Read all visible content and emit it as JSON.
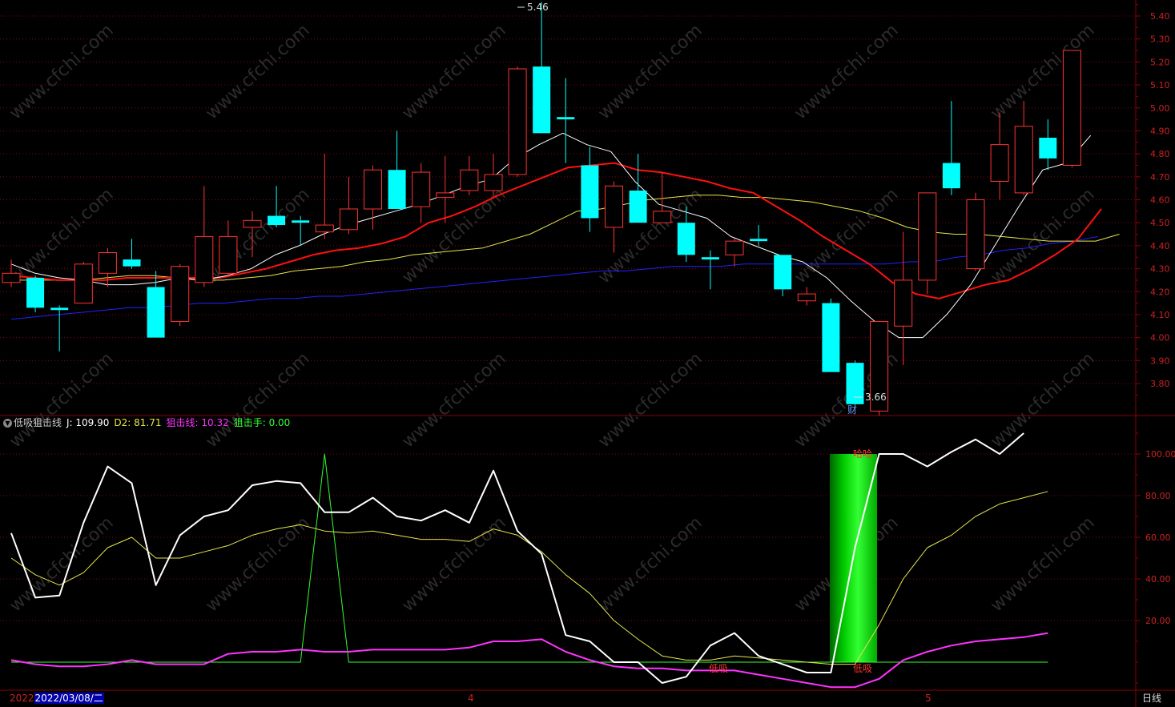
{
  "colors": {
    "up": "#ff3333",
    "down": "#00ffff",
    "grid": "#8b0000",
    "axis_text": "#cc2222",
    "ma5": "#ffffff",
    "ma10": "#ff1010",
    "ma20": "#e6e64d",
    "ma60": "#2222ff",
    "j_line": "#ffffff",
    "d2_line": "#e6e64d",
    "snipe_line": "#ff33ff",
    "sniper_hand": "#33ff33",
    "signal_bar": "#00dd00"
  },
  "header": {
    "indicator_name": "低吸狙击线",
    "j_label": "J: 109.90",
    "d2_label": "D2: 81.71",
    "snipe_label": "狙击线: 10.32",
    "hand_label": "狙击手: 0.00"
  },
  "bottom": {
    "year": "2022",
    "cursor_date": "2022/03/08/二",
    "month_4": "4",
    "month_5": "5",
    "period": "日线"
  },
  "chart_data": [
    {
      "type": "candlestick",
      "y_ticks": [
        5.4,
        5.3,
        5.2,
        5.1,
        5.0,
        4.9,
        4.8,
        4.7,
        4.6,
        4.5,
        4.4,
        4.3,
        4.2,
        4.1,
        4.0,
        3.9,
        3.8
      ],
      "ylim": [
        3.66,
        5.46
      ],
      "annotations": {
        "high": "5.46",
        "low": "3.66",
        "marker": "财"
      },
      "candles": [
        {
          "o": 4.24,
          "h": 4.34,
          "l": 4.22,
          "c": 4.28
        },
        {
          "o": 4.26,
          "h": 4.27,
          "l": 4.11,
          "c": 4.13
        },
        {
          "o": 4.13,
          "h": 4.14,
          "l": 3.94,
          "c": 4.12
        },
        {
          "o": 4.15,
          "h": 4.33,
          "l": 4.15,
          "c": 4.32
        },
        {
          "o": 4.28,
          "h": 4.39,
          "l": 4.22,
          "c": 4.37
        },
        {
          "o": 4.34,
          "h": 4.43,
          "l": 4.3,
          "c": 4.31
        },
        {
          "o": 4.22,
          "h": 4.29,
          "l": 4.0,
          "c": 4.0
        },
        {
          "o": 4.07,
          "h": 4.32,
          "l": 4.05,
          "c": 4.31
        },
        {
          "o": 4.24,
          "h": 4.66,
          "l": 4.22,
          "c": 4.44
        },
        {
          "o": 4.28,
          "h": 4.51,
          "l": 4.27,
          "c": 4.44
        },
        {
          "o": 4.48,
          "h": 4.55,
          "l": 4.35,
          "c": 4.51
        },
        {
          "o": 4.53,
          "h": 4.66,
          "l": 4.48,
          "c": 4.49
        },
        {
          "o": 4.51,
          "h": 4.53,
          "l": 4.4,
          "c": 4.5
        },
        {
          "o": 4.46,
          "h": 4.8,
          "l": 4.43,
          "c": 4.49
        },
        {
          "o": 4.47,
          "h": 4.7,
          "l": 4.45,
          "c": 4.56
        },
        {
          "o": 4.56,
          "h": 4.75,
          "l": 4.47,
          "c": 4.73
        },
        {
          "o": 4.73,
          "h": 4.9,
          "l": 4.56,
          "c": 4.56
        },
        {
          "o": 4.57,
          "h": 4.76,
          "l": 4.5,
          "c": 4.72
        },
        {
          "o": 4.61,
          "h": 4.79,
          "l": 4.5,
          "c": 4.63
        },
        {
          "o": 4.64,
          "h": 4.79,
          "l": 4.62,
          "c": 4.73
        },
        {
          "o": 4.64,
          "h": 4.8,
          "l": 4.62,
          "c": 4.71
        },
        {
          "o": 4.71,
          "h": 5.18,
          "l": 4.7,
          "c": 5.17
        },
        {
          "o": 5.18,
          "h": 5.46,
          "l": 4.89,
          "c": 4.89
        },
        {
          "o": 4.96,
          "h": 5.13,
          "l": 4.76,
          "c": 4.95
        },
        {
          "o": 4.75,
          "h": 4.83,
          "l": 4.46,
          "c": 4.52
        },
        {
          "o": 4.48,
          "h": 4.68,
          "l": 4.37,
          "c": 4.66
        },
        {
          "o": 4.64,
          "h": 4.8,
          "l": 4.5,
          "c": 4.5
        },
        {
          "o": 4.5,
          "h": 4.72,
          "l": 4.5,
          "c": 4.55
        },
        {
          "o": 4.5,
          "h": 4.57,
          "l": 4.33,
          "c": 4.36
        },
        {
          "o": 4.35,
          "h": 4.38,
          "l": 4.21,
          "c": 4.34
        },
        {
          "o": 4.36,
          "h": 4.43,
          "l": 4.31,
          "c": 4.42
        },
        {
          "o": 4.43,
          "h": 4.49,
          "l": 4.4,
          "c": 4.42
        },
        {
          "o": 4.36,
          "h": 4.36,
          "l": 4.18,
          "c": 4.21
        },
        {
          "o": 4.16,
          "h": 4.22,
          "l": 4.14,
          "c": 4.19
        },
        {
          "o": 4.15,
          "h": 4.17,
          "l": 3.85,
          "c": 3.85
        },
        {
          "o": 3.89,
          "h": 3.9,
          "l": 3.7,
          "c": 3.71
        },
        {
          "o": 3.68,
          "h": 4.07,
          "l": 3.66,
          "c": 4.07
        },
        {
          "o": 4.05,
          "h": 4.46,
          "l": 3.88,
          "c": 4.25
        },
        {
          "o": 4.25,
          "h": 4.63,
          "l": 4.19,
          "c": 4.63
        },
        {
          "o": 4.76,
          "h": 5.03,
          "l": 4.62,
          "c": 4.65
        },
        {
          "o": 4.3,
          "h": 4.63,
          "l": 4.29,
          "c": 4.6
        },
        {
          "o": 4.68,
          "h": 4.98,
          "l": 4.6,
          "c": 4.84
        },
        {
          "o": 4.63,
          "h": 5.03,
          "l": 4.62,
          "c": 4.92
        },
        {
          "o": 4.87,
          "h": 4.95,
          "l": 4.73,
          "c": 4.78
        },
        {
          "o": 4.75,
          "h": 5.25,
          "l": 4.74,
          "c": 5.25
        }
      ],
      "ma5": [
        4.32,
        4.28,
        4.26,
        4.25,
        4.23,
        4.23,
        4.24,
        4.26,
        4.25,
        4.27,
        4.3,
        4.36,
        4.4,
        4.45,
        4.49,
        4.52,
        4.55,
        4.58,
        4.62,
        4.66,
        4.69,
        4.78,
        4.84,
        4.89,
        4.84,
        4.81,
        4.68,
        4.58,
        4.55,
        4.52,
        4.44,
        4.4,
        4.36,
        4.33,
        4.26,
        4.16,
        4.07,
        4.0,
        4.0,
        4.1,
        4.23,
        4.4,
        4.57,
        4.73,
        4.76,
        4.88
      ],
      "ma10": [
        4.27,
        4.26,
        4.25,
        4.25,
        4.25,
        4.26,
        4.26,
        4.26,
        4.26,
        4.26,
        4.28,
        4.3,
        4.33,
        4.36,
        4.38,
        4.39,
        4.41,
        4.44,
        4.5,
        4.53,
        4.57,
        4.62,
        4.66,
        4.7,
        4.74,
        4.75,
        4.76,
        4.73,
        4.72,
        4.7,
        4.68,
        4.65,
        4.63,
        4.57,
        4.51,
        4.44,
        4.38,
        4.32,
        4.24,
        4.19,
        4.17,
        4.2,
        4.23,
        4.25,
        4.3,
        4.36,
        4.43,
        4.56
      ],
      "ma20": [
        4.25,
        4.25,
        4.25,
        4.25,
        4.26,
        4.27,
        4.27,
        4.26,
        4.25,
        4.25,
        4.26,
        4.27,
        4.29,
        4.3,
        4.31,
        4.33,
        4.34,
        4.36,
        4.37,
        4.38,
        4.39,
        4.42,
        4.45,
        4.5,
        4.55,
        4.56,
        4.58,
        4.6,
        4.61,
        4.62,
        4.62,
        4.61,
        4.61,
        4.6,
        4.59,
        4.57,
        4.55,
        4.52,
        4.48,
        4.46,
        4.45,
        4.45,
        4.44,
        4.43,
        4.42,
        4.42,
        4.42,
        4.45
      ],
      "ma60": [
        4.08,
        4.09,
        4.1,
        4.11,
        4.12,
        4.13,
        4.13,
        4.14,
        4.15,
        4.15,
        4.16,
        4.17,
        4.17,
        4.18,
        4.18,
        4.19,
        4.2,
        4.21,
        4.22,
        4.23,
        4.24,
        4.25,
        4.26,
        4.27,
        4.28,
        4.29,
        4.29,
        4.3,
        4.31,
        4.31,
        4.31,
        4.32,
        4.32,
        4.32,
        4.32,
        4.32,
        4.32,
        4.32,
        4.33,
        4.33,
        4.35,
        4.36,
        4.38,
        4.39,
        4.41,
        4.42,
        4.44
      ]
    },
    {
      "type": "line",
      "y_ticks": [
        100.0,
        80.0,
        60.0,
        40.0,
        20.0
      ],
      "ylim": [
        -12,
        112
      ],
      "signal_labels": {
        "high": "哈哈",
        "low": "低吸",
        "low2": "低吸"
      },
      "series": [
        {
          "name": "J",
          "values": [
            62,
            31,
            32,
            67,
            94,
            86,
            37,
            61,
            70,
            73,
            85,
            87,
            86,
            72,
            72,
            79,
            70,
            68,
            73,
            67,
            92,
            63,
            52,
            13,
            10,
            0,
            0,
            -10,
            -7,
            8,
            14,
            3,
            -1,
            -5,
            -5,
            55,
            100,
            100,
            94,
            101,
            107,
            100,
            110
          ]
        },
        {
          "name": "D2",
          "values": [
            50,
            42,
            37,
            43,
            55,
            60,
            50,
            50,
            53,
            56,
            61,
            64,
            66,
            63,
            62,
            63,
            61,
            59,
            59,
            58,
            64,
            61,
            53,
            42,
            33,
            20,
            11,
            3,
            1,
            1,
            3,
            2,
            1,
            0,
            -1,
            -1,
            18,
            40,
            55,
            61,
            70,
            76,
            79,
            82
          ]
        },
        {
          "name": "狙击线",
          "values": [
            1,
            -1,
            -2,
            -2,
            -1,
            1,
            -1,
            -1,
            -1,
            4,
            5,
            5,
            6,
            5,
            5,
            6,
            6,
            6,
            6,
            7,
            10,
            10,
            11,
            5,
            1,
            -2,
            -3,
            -3,
            -4,
            -4,
            -4,
            -6,
            -8,
            -10,
            -12,
            -12,
            -8,
            1,
            5,
            8,
            10,
            11,
            12,
            14
          ]
        },
        {
          "name": "狙击手",
          "values": [
            0,
            0,
            0,
            0,
            0,
            0,
            0,
            0,
            0,
            0,
            0,
            0,
            0,
            100,
            0,
            0,
            0,
            0,
            0,
            0,
            0,
            0,
            0,
            0,
            0,
            0,
            0,
            0,
            0,
            0,
            0,
            0,
            0,
            0,
            0,
            0,
            0,
            0,
            0,
            0,
            0,
            0,
            0,
            0
          ]
        }
      ],
      "signal_bar": {
        "value_top": 100,
        "value_bottom": 0
      }
    }
  ]
}
